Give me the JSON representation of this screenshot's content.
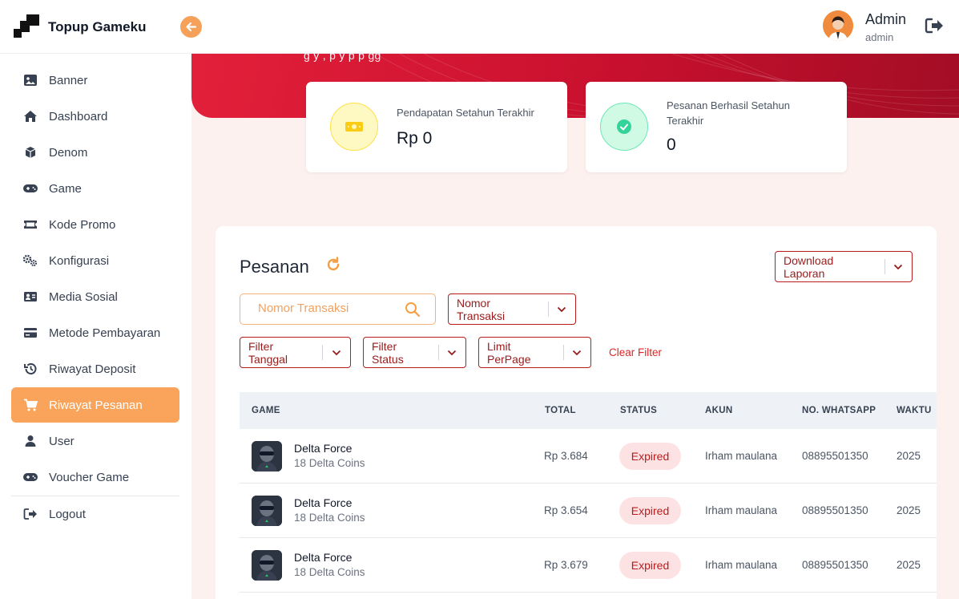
{
  "header": {
    "brand": "Topup Gameku",
    "collapse_icon": "arrow-left-icon",
    "user_name": "Admin",
    "user_role": "admin",
    "logout_icon": "logout-icon"
  },
  "sidebar": {
    "items": [
      {
        "label": "Banner",
        "icon": "image-icon"
      },
      {
        "label": "Dashboard",
        "icon": "home-icon"
      },
      {
        "label": "Denom",
        "icon": "cube-icon"
      },
      {
        "label": "Game",
        "icon": "gamepad-icon"
      },
      {
        "label": "Kode Promo",
        "icon": "ticket-icon"
      },
      {
        "label": "Konfigurasi",
        "icon": "gears-icon"
      },
      {
        "label": "Media Sosial",
        "icon": "id-card-icon"
      },
      {
        "label": "Metode Pembayaran",
        "icon": "credit-card-icon"
      },
      {
        "label": "Riwayat Deposit",
        "icon": "history-icon"
      },
      {
        "label": "Riwayat Pesanan",
        "icon": "cart-icon",
        "active": true
      },
      {
        "label": "User",
        "icon": "user-icon"
      },
      {
        "label": "Voucher Game",
        "icon": "gamepad-icon"
      }
    ],
    "logout_label": "Logout"
  },
  "hero": {
    "text": "g          y          ,  p         y   p       p  gg"
  },
  "stats": {
    "revenue": {
      "label": "Pendapatan Setahun Terakhir",
      "value": "Rp 0",
      "icon": "money-icon"
    },
    "orders": {
      "label": "Pesanan Berhasil Setahun Terakhir",
      "value": "0",
      "icon": "check-circle-icon"
    }
  },
  "orders": {
    "title": "Pesanan",
    "download_label": "Download Laporan",
    "search_placeholder": "Nomor Transaksi",
    "search_field_select": "Nomor Transaksi",
    "filter_date": "Filter Tanggal",
    "filter_status": "Filter Status",
    "limit_per_page": "Limit PerPage",
    "clear_filter": "Clear Filter",
    "columns": [
      "GAME",
      "TOTAL",
      "STATUS",
      "AKUN",
      "NO. WHATSAPP",
      "WAKTU"
    ],
    "rows": [
      {
        "game": "Delta Force",
        "item": "18 Delta Coins",
        "total": "Rp 3.684",
        "status": "Expired",
        "akun": "Irham maulana",
        "whatsapp": "08895501350",
        "waktu": "2025"
      },
      {
        "game": "Delta Force",
        "item": "18 Delta Coins",
        "total": "Rp 3.654",
        "status": "Expired",
        "akun": "Irham maulana",
        "whatsapp": "08895501350",
        "waktu": "2025"
      },
      {
        "game": "Delta Force",
        "item": "18 Delta Coins",
        "total": "Rp 3.679",
        "status": "Expired",
        "akun": "Irham maulana",
        "whatsapp": "08895501350",
        "waktu": "2025"
      }
    ]
  },
  "colors": {
    "accent": "#f9a35b",
    "hero_red": "#c8102e",
    "danger": "#b91c1c",
    "badge_bg": "#fde2e4"
  }
}
